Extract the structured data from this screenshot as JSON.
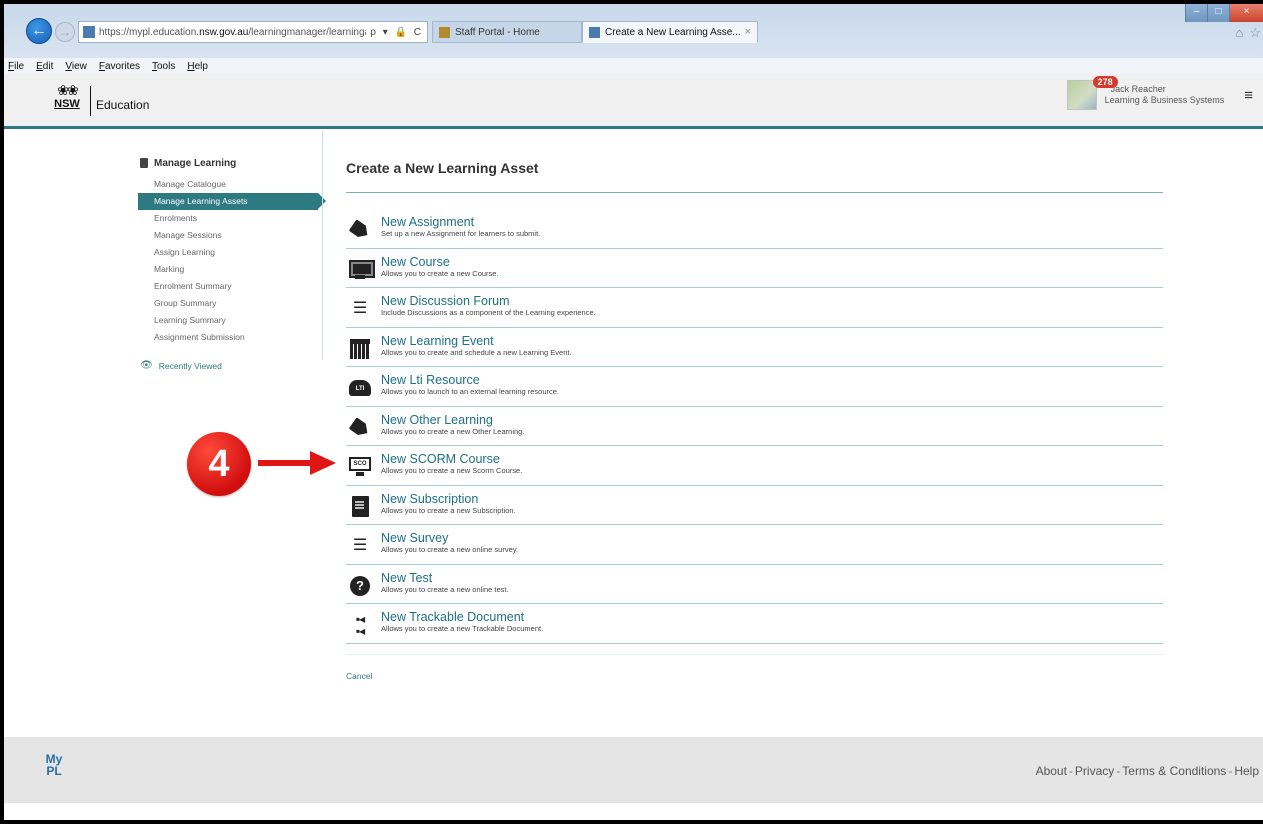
{
  "browser": {
    "url_prefix": "https://mypl.education.",
    "url_domain": "nsw.gov.au",
    "url_path": "/learningmanager/learningasset/cr",
    "address_tools": "ρ ▾ 🔒 C",
    "tabs": [
      {
        "title": "Staff Portal - Home"
      },
      {
        "title": "Create a New Learning Asse...",
        "close": "×"
      }
    ],
    "menu": [
      "File",
      "Edit",
      "View",
      "Favorites",
      "Tools",
      "Help"
    ]
  },
  "header": {
    "logo_nsw": "NSW",
    "logo_edu": "Education",
    "notif_count": "278",
    "user_name": "Jack Reacher",
    "user_role": "Learning & Business Systems",
    "menu_glyph": "≡"
  },
  "sidebar": {
    "title": "Manage Learning",
    "items": [
      {
        "label": "Manage Catalogue"
      },
      {
        "label": "Manage Learning Assets"
      },
      {
        "label": "Enrolments"
      },
      {
        "label": "Manage Sessions"
      },
      {
        "label": "Assign Learning"
      },
      {
        "label": "Marking"
      },
      {
        "label": "Enrolment Summary"
      },
      {
        "label": "Group Summary"
      },
      {
        "label": "Learning Summary"
      },
      {
        "label": "Assignment Submission"
      }
    ],
    "active_index": 1,
    "recent_label": "Recently Viewed"
  },
  "main": {
    "title": "Create a New Learning Asset",
    "assets": [
      {
        "name": "New Assignment",
        "desc": "Set up a new Assignment for learners to submit.",
        "icon": "tag-icon"
      },
      {
        "name": "New Course",
        "desc": "Allows you to create a new Course.",
        "icon": "monitor-icon"
      },
      {
        "name": "New Discussion Forum",
        "desc": "Include Discussions as a component of the Learning experience.",
        "icon": "list-icon"
      },
      {
        "name": "New Learning Event",
        "desc": "Allows you to create and schedule a new Learning Event.",
        "icon": "calendar-icon"
      },
      {
        "name": "New Lti Resource",
        "desc": "Allows you to launch to an external learning resource.",
        "icon": "lti-cloud-icon"
      },
      {
        "name": "New Other Learning",
        "desc": "Allows you to create a new Other Learning.",
        "icon": "tag-icon"
      },
      {
        "name": "New SCORM Course",
        "desc": "Allows you to create a new Scorm Course.",
        "icon": "sco-monitor-icon"
      },
      {
        "name": "New Subscription",
        "desc": "Allows you to create a new Subscription.",
        "icon": "subscription-icon"
      },
      {
        "name": "New Survey",
        "desc": "Allows you to create a new online survey.",
        "icon": "list-icon"
      },
      {
        "name": "New Test",
        "desc": "Allows you to create a new online test.",
        "icon": "question-icon"
      },
      {
        "name": "New Trackable Document",
        "desc": "Allows you to create a new Trackable Document.",
        "icon": "trackable-doc-icon"
      }
    ],
    "cancel_label": "Cancel"
  },
  "annotation": {
    "step_number": "4"
  },
  "footer": {
    "logo_text": "MyPL",
    "links": [
      "About",
      "Privacy",
      "Terms & Conditions",
      "Help"
    ],
    "separator": "-"
  },
  "colors": {
    "accent": "#2e7a83",
    "link": "#1f6f87",
    "annotation": "#e01515"
  }
}
